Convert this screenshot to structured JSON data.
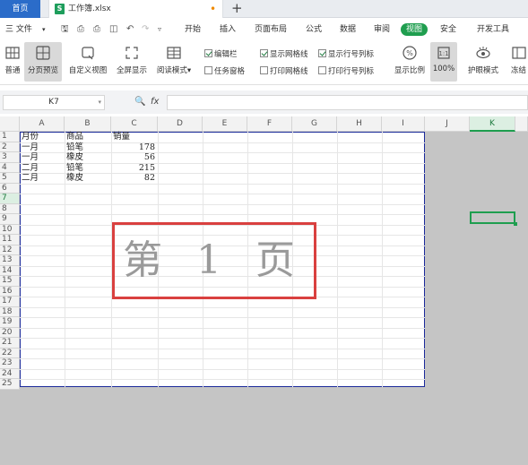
{
  "tabs": {
    "home_label": "首页",
    "file_label": "工作簿.xlsx",
    "file_icon": "S",
    "modified_dot": "•",
    "new_tab": "+"
  },
  "menu": {
    "file_label": "三 文件",
    "items": [
      "开始",
      "插入",
      "页面布局",
      "公式",
      "数据",
      "审阅",
      "视图",
      "安全",
      "开发工具"
    ],
    "active": "视图"
  },
  "ribbon": {
    "buttons": [
      "普通",
      "分页预览",
      "自定义视图",
      "全屏显示",
      "阅读模式"
    ],
    "reading_mode_arrow": "▾",
    "checkboxes": [
      {
        "label": "编辑栏",
        "checked": true
      },
      {
        "label": "任务窗格",
        "checked": false
      },
      {
        "label": "显示网格线",
        "checked": true
      },
      {
        "label": "打印网格线",
        "checked": false
      },
      {
        "label": "显示行号列标",
        "checked": true
      },
      {
        "label": "打印行号列标",
        "checked": false
      }
    ],
    "zoom_buttons": [
      "显示比例",
      "100%"
    ],
    "eye_label": "护眼模式",
    "freeze_label": "冻结"
  },
  "formula_bar": {
    "cell_ref": "K7",
    "fx": "fx",
    "value": ""
  },
  "sheet": {
    "columns": [
      "A",
      "B",
      "C",
      "D",
      "E",
      "F",
      "G",
      "H",
      "I",
      "J",
      "K"
    ],
    "selected_column": "K",
    "rows": [
      "1",
      "2",
      "3",
      "4",
      "5",
      "6",
      "7",
      "8",
      "9",
      "10",
      "11",
      "12",
      "13",
      "14",
      "15",
      "16",
      "17",
      "18",
      "19",
      "20",
      "21",
      "22",
      "23",
      "24",
      "25"
    ],
    "selected_row": "7",
    "data": [
      [
        "月份",
        "商品",
        "销量"
      ],
      [
        "一月",
        "铅笔",
        "178"
      ],
      [
        "一月",
        "橡皮",
        "56"
      ],
      [
        "二月",
        "铅笔",
        "215"
      ],
      [
        "二月",
        "橡皮",
        "82"
      ]
    ],
    "page_label": "第 1 页"
  },
  "colors": {
    "accent_green": "#1f9e4f",
    "home_tab_blue": "#2b6cc9",
    "page_border": "#1b2a9a",
    "page_label_box": "#d9403f"
  }
}
